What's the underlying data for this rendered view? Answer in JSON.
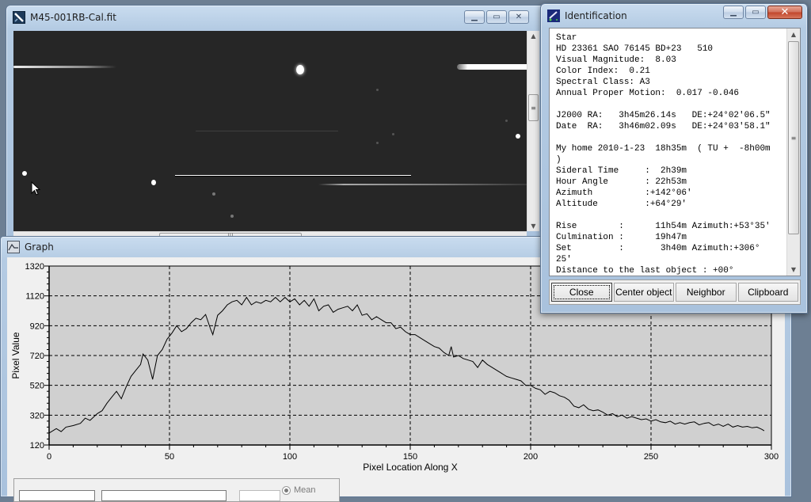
{
  "image_window": {
    "title": "M45-001RB-Cal.fit",
    "icon": "fits-image-icon",
    "buttons": {
      "minimize": "minimize",
      "maximize": "restore",
      "close": "close"
    }
  },
  "identification_window": {
    "title": "Identification",
    "icon": "telescope-icon",
    "lines": [
      "Star",
      "HD 23361 SAO 76145 BD+23   510",
      "Visual Magnitude:  8.03",
      "Color Index:  0.21",
      "Spectral Class: A3",
      "Annual Proper Motion:  0.017 -0.046",
      "",
      "J2000 RA:   3h45m26.14s   DE:+24°02'06.5\"",
      "Date  RA:   3h46m02.09s   DE:+24°03'58.1\"",
      "",
      "My home 2010-1-23  18h35m  ( TU +  -8h00m",
      ")",
      "Sideral Time     :  2h39m",
      "Hour Angle       : 22h53m",
      "Azimuth          :+142°06'",
      "Altitude         :+64°29'",
      "",
      "Rise        :      11h54m Azimuth:+53°35'",
      "Culmination :      19h47m",
      "Set         :       3h40m Azimuth:+306°",
      "25'",
      "Distance to the last object : +00°"
    ],
    "buttons": {
      "close": "Close",
      "center_object": "Center object",
      "neighbor": "Neighbor",
      "clipboard": "Clipboard"
    }
  },
  "graph_window": {
    "title": "Graph",
    "icon": "graph-icon",
    "controls": {
      "mean_label": "Mean"
    }
  },
  "chart_data": {
    "type": "line",
    "title": "",
    "xlabel": "Pixel Location Along X",
    "ylabel": "Pixel Value",
    "xlim": [
      0,
      300
    ],
    "ylim": [
      120,
      1320
    ],
    "xticks": [
      0,
      50,
      100,
      150,
      200,
      250,
      300
    ],
    "yticks": [
      120,
      320,
      520,
      720,
      920,
      1120,
      1320
    ],
    "grid": true,
    "series": [
      {
        "name": "profile",
        "x": [
          0,
          3,
          5,
          7,
          10,
          13,
          15,
          17,
          20,
          22,
          24,
          26,
          28,
          30,
          32,
          34,
          36,
          38,
          39,
          41,
          43,
          45,
          47,
          49,
          51,
          53,
          55,
          57,
          59,
          61,
          63,
          65,
          67,
          68,
          70,
          72,
          74,
          76,
          78,
          80,
          82,
          84,
          86,
          88,
          90,
          92,
          94,
          96,
          98,
          100,
          102,
          104,
          106,
          108,
          110,
          112,
          114,
          116,
          118,
          120,
          122,
          124,
          126,
          128,
          130,
          132,
          134,
          136,
          138,
          140,
          142,
          144,
          146,
          148,
          150,
          152,
          154,
          156,
          158,
          160,
          162,
          164,
          166,
          167,
          168,
          170,
          172,
          174,
          176,
          178,
          180,
          182,
          184,
          186,
          188,
          190,
          192,
          194,
          196,
          198,
          200,
          202,
          204,
          206,
          208,
          210,
          212,
          214,
          216,
          218,
          220,
          222,
          224,
          226,
          228,
          230,
          232,
          234,
          236,
          238,
          240,
          242,
          244,
          246,
          248,
          250,
          252,
          254,
          256,
          258,
          260,
          262,
          264,
          266,
          268,
          270,
          272,
          274,
          276,
          278,
          280,
          282,
          284,
          286,
          288,
          290,
          292,
          294,
          296,
          297
        ],
        "y": [
          200,
          230,
          210,
          240,
          250,
          265,
          300,
          285,
          330,
          350,
          400,
          440,
          480,
          430,
          510,
          580,
          620,
          660,
          730,
          690,
          560,
          720,
          760,
          830,
          870,
          920,
          880,
          900,
          940,
          970,
          960,
          995,
          900,
          860,
          990,
          1020,
          1060,
          1080,
          1090,
          1060,
          1110,
          1060,
          1080,
          1070,
          1090,
          1080,
          1110,
          1080,
          1110,
          1080,
          1100,
          1060,
          1090,
          1050,
          1100,
          1020,
          1050,
          1060,
          1010,
          1030,
          1040,
          1050,
          1020,
          1060,
          990,
          1000,
          960,
          980,
          960,
          940,
          940,
          900,
          910,
          880,
          860,
          860,
          840,
          820,
          800,
          780,
          770,
          740,
          720,
          780,
          710,
          720,
          700,
          690,
          680,
          640,
          690,
          660,
          640,
          620,
          600,
          580,
          570,
          560,
          550,
          520,
          520,
          500,
          490,
          460,
          480,
          470,
          450,
          440,
          420,
          380,
          370,
          390,
          360,
          350,
          355,
          340,
          320,
          330,
          310,
          320,
          300,
          310,
          300,
          290,
          295,
          280,
          290,
          275,
          270,
          280,
          260,
          270,
          260,
          270,
          275,
          255,
          265,
          270,
          250,
          260,
          245,
          260,
          240,
          250,
          240,
          245,
          235,
          240,
          225,
          215
        ]
      }
    ]
  }
}
